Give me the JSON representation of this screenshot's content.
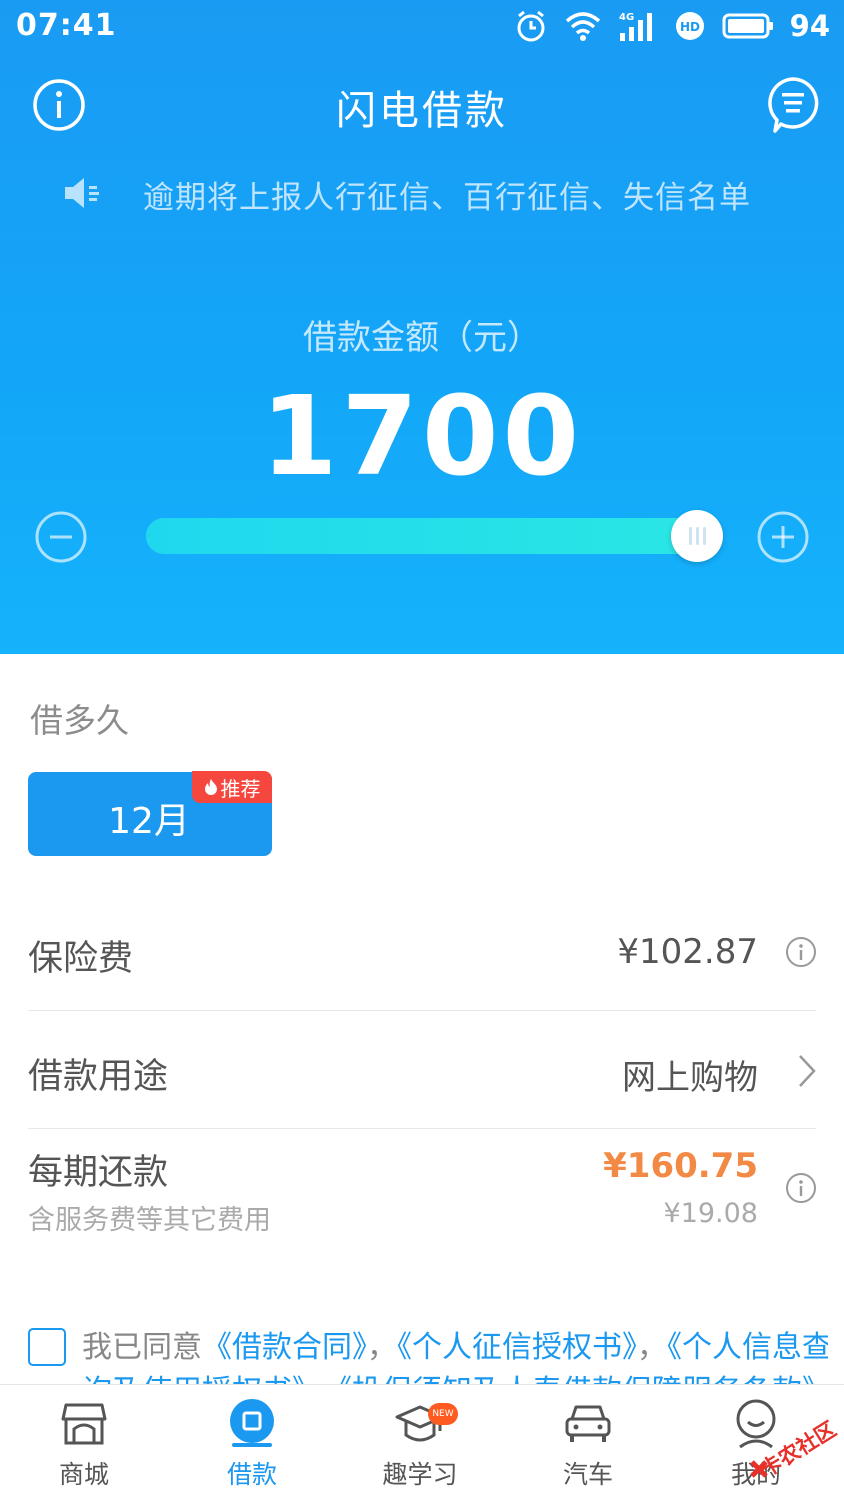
{
  "status_bar": {
    "time": "07:41",
    "battery": "94",
    "network": "4G",
    "hd": "HD"
  },
  "nav": {
    "title": "闪电借款"
  },
  "notice": {
    "text": "逾期将上报人行征信、百行征信、失信名单"
  },
  "loan": {
    "amount_label": "借款金额（元）",
    "amount": "1700",
    "slider_fraction": 0.98
  },
  "term": {
    "label": "借多久",
    "selected": "12月",
    "badge": "推荐"
  },
  "details": {
    "insurance_label": "保险费",
    "insurance_value": "¥102.87",
    "purpose_label": "借款用途",
    "purpose_value": "网上购物",
    "installment_label": "每期还款",
    "installment_sub": "含服务费等其它费用",
    "installment_value": "¥160.75",
    "installment_sub_value": "¥19.08"
  },
  "agreement": {
    "prefix": "我已同意",
    "link1": "《借款合同》",
    "sep": "，",
    "link2": "《个人征信授权书》",
    "link3": "《个人信息查询及使用授权书》",
    "link4": "《投保须知及人寿借款保障服务条款》"
  },
  "tabs": [
    {
      "label": "商城",
      "icon": "store-icon"
    },
    {
      "label": "借款",
      "icon": "loan-icon"
    },
    {
      "label": "趣学习",
      "icon": "graduation-cap-icon",
      "badge": "NEW"
    },
    {
      "label": "汽车",
      "icon": "car-icon"
    },
    {
      "label": "我的",
      "icon": "profile-icon"
    }
  ],
  "watermark": {
    "text": "卡农社区"
  },
  "colors": {
    "primary": "#1b98ef",
    "accent_orange": "#f28a45",
    "badge_red": "#f5473e",
    "slider_fill": "#2ae6e4"
  }
}
